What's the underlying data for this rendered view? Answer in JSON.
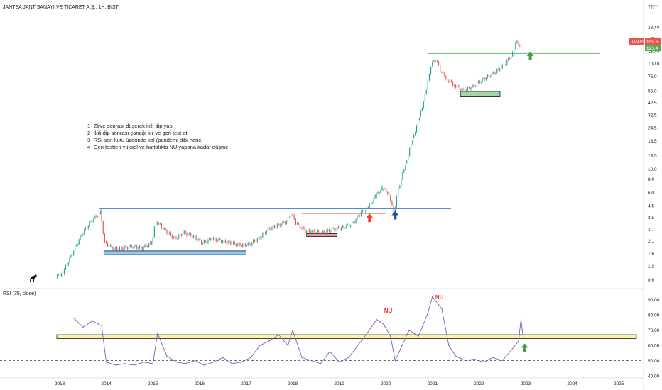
{
  "header": {
    "title": "JANTSA JANT SANAYİ VE TİCARET A.Ş., 1H, BIST",
    "currency": "TRY"
  },
  "notes": [
    "1- Zirve sonrası düşerek ikili dip yap",
    "2- İkili dip sonrası çanağı kır ve geri test et",
    "3- RSI sarı kutu üzerinde kal (pandemi dibi hariç)",
    "4- Geri testten yüksel ve haftalıkta NU yapana kadar düşme"
  ],
  "price_badges": {
    "symbol": "JANTS",
    "last": "135.6",
    "level": "123.4"
  },
  "colors": {
    "up": "#26a69a",
    "down": "#ef5350",
    "rsi": "#7e57c2",
    "support_blue": "#4a90d9",
    "resistance_red": "#f44336",
    "box_yellow": "#fff59d",
    "box_green": "#a5d6a7",
    "box_blue": "#90caf9",
    "box_red": "#ef9a9a",
    "arrow_red": "#f44336",
    "arrow_blue": "#1e4fa8",
    "arrow_green": "#43a047"
  },
  "annotations": {
    "rsi_marker_1": "NU",
    "rsi_marker_2": "NU"
  },
  "chart_data": [
    {
      "type": "candlestick",
      "title": "JANTSA JANT SANAYİ VE TİCARET A.Ş., 1H, BIST",
      "yscale": "log",
      "ylim": [
        0.8,
        290
      ],
      "yticks": [
        "220.0",
        "170.0",
        "130.0",
        "100.0",
        "75.0",
        "55.0",
        "42.5",
        "32.5",
        "24.5",
        "18.5",
        "13.5",
        "10.0",
        "8.0",
        "6.0",
        "4.5",
        "3.5",
        "2.7",
        "2.1",
        "1.6",
        "1.2",
        "0.9"
      ],
      "xticks": [
        "2013",
        "2014",
        "2015",
        "2016",
        "2017",
        "2018",
        "2019",
        "2020",
        "2021",
        "2022",
        "2023",
        "2024",
        "2025"
      ],
      "x": [
        2012.95,
        2013.1,
        2013.3,
        2013.5,
        2013.7,
        2013.85,
        2013.9,
        2014.0,
        2014.2,
        2014.4,
        2014.6,
        2014.8,
        2015.0,
        2015.1,
        2015.3,
        2015.5,
        2015.7,
        2015.9,
        2016.1,
        2016.3,
        2016.5,
        2016.7,
        2016.9,
        2017.1,
        2017.3,
        2017.5,
        2017.7,
        2017.9,
        2018.0,
        2018.1,
        2018.3,
        2018.5,
        2018.7,
        2018.9,
        2019.1,
        2019.3,
        2019.5,
        2019.65,
        2019.8,
        2019.95,
        2020.1,
        2020.2,
        2020.3,
        2020.45,
        2020.6,
        2020.75,
        2020.9,
        2021.0,
        2021.1,
        2021.2,
        2021.35,
        2021.5,
        2021.7,
        2021.9,
        2022.1,
        2022.3,
        2022.5,
        2022.6,
        2022.75,
        2022.85,
        2022.9
      ],
      "close": [
        0.95,
        1.05,
        1.6,
        2.4,
        3.2,
        3.7,
        4.1,
        2.0,
        1.75,
        1.8,
        1.85,
        1.8,
        2.0,
        3.2,
        2.6,
        2.2,
        2.5,
        2.3,
        2.0,
        2.2,
        2.1,
        2.0,
        1.9,
        1.95,
        2.2,
        2.7,
        2.9,
        3.2,
        3.8,
        3.1,
        2.6,
        2.55,
        2.5,
        2.7,
        2.8,
        3.0,
        3.9,
        4.3,
        5.5,
        6.6,
        5.8,
        3.8,
        6.5,
        11,
        19,
        31,
        55,
        95,
        110,
        85,
        70,
        62,
        55,
        60,
        70,
        78,
        90,
        100,
        123,
        165,
        140
      ],
      "series": [
        {
          "name": "JANTS",
          "values": "close"
        }
      ],
      "horizontal_lines": [
        {
          "y": 4.2,
          "x_from": 2013.85,
          "x_to": 2021.4,
          "color": "support_blue"
        },
        {
          "y": 3.8,
          "x_from": 2018.2,
          "x_to": 2020.0,
          "color": "resistance_red"
        },
        {
          "y": 123.4,
          "x_from": 2020.9,
          "x_to": 2024.6,
          "color": "box_green"
        }
      ],
      "zones": [
        {
          "y_low": 1.55,
          "y_high": 1.68,
          "x_from": 2013.95,
          "x_to": 2017.0,
          "color": "box_blue"
        },
        {
          "y_low": 2.3,
          "y_high": 2.45,
          "x_from": 2018.3,
          "x_to": 2018.95,
          "color": "box_red"
        },
        {
          "y_low": 48,
          "y_high": 54,
          "x_from": 2021.6,
          "x_to": 2022.45,
          "color": "box_green"
        }
      ],
      "arrows": [
        {
          "x": 2019.65,
          "y": 3.4,
          "color": "arrow_red"
        },
        {
          "x": 2020.2,
          "y": 3.6,
          "color": "arrow_blue"
        },
        {
          "x": 2023.1,
          "y": 115,
          "color": "arrow_green"
        }
      ]
    },
    {
      "type": "line",
      "title": "RSI (35, close)",
      "ylim": [
        40,
        95
      ],
      "yticks": [
        "90.00",
        "80.00",
        "70.00",
        "60.00",
        "50.00",
        "40.00"
      ],
      "reference_line": 50,
      "x": [
        2013.3,
        2013.5,
        2013.7,
        2013.9,
        2014.0,
        2014.2,
        2014.4,
        2014.6,
        2014.8,
        2015.0,
        2015.1,
        2015.3,
        2015.5,
        2015.7,
        2015.9,
        2016.1,
        2016.3,
        2016.5,
        2016.7,
        2016.9,
        2017.1,
        2017.3,
        2017.5,
        2017.7,
        2017.9,
        2018.0,
        2018.2,
        2018.4,
        2018.6,
        2018.8,
        2019.0,
        2019.2,
        2019.4,
        2019.6,
        2019.8,
        2019.95,
        2020.1,
        2020.2,
        2020.35,
        2020.5,
        2020.7,
        2020.9,
        2021.0,
        2021.2,
        2021.35,
        2021.5,
        2021.7,
        2021.9,
        2022.1,
        2022.3,
        2022.5,
        2022.7,
        2022.85,
        2022.9,
        2022.95
      ],
      "values": [
        78,
        72,
        76,
        73,
        49,
        47,
        48,
        47,
        49,
        48,
        68,
        53,
        49,
        48,
        50,
        47,
        49,
        52,
        48,
        49,
        52,
        60,
        63,
        67,
        60,
        70,
        52,
        50,
        48,
        56,
        49,
        52,
        60,
        68,
        77,
        74,
        66,
        50,
        60,
        70,
        66,
        81,
        92,
        84,
        60,
        53,
        50,
        51,
        49,
        52,
        50,
        57,
        63,
        77,
        65
      ],
      "yellow_zone": [
        64.5,
        67
      ],
      "markers": [
        {
          "label_key": "rsi_marker_1",
          "x": 2020.05
        },
        {
          "label_key": "rsi_marker_2",
          "x": 2021.15
        }
      ],
      "arrow": {
        "x": 2022.98,
        "y": 58,
        "color": "arrow_green"
      }
    }
  ]
}
